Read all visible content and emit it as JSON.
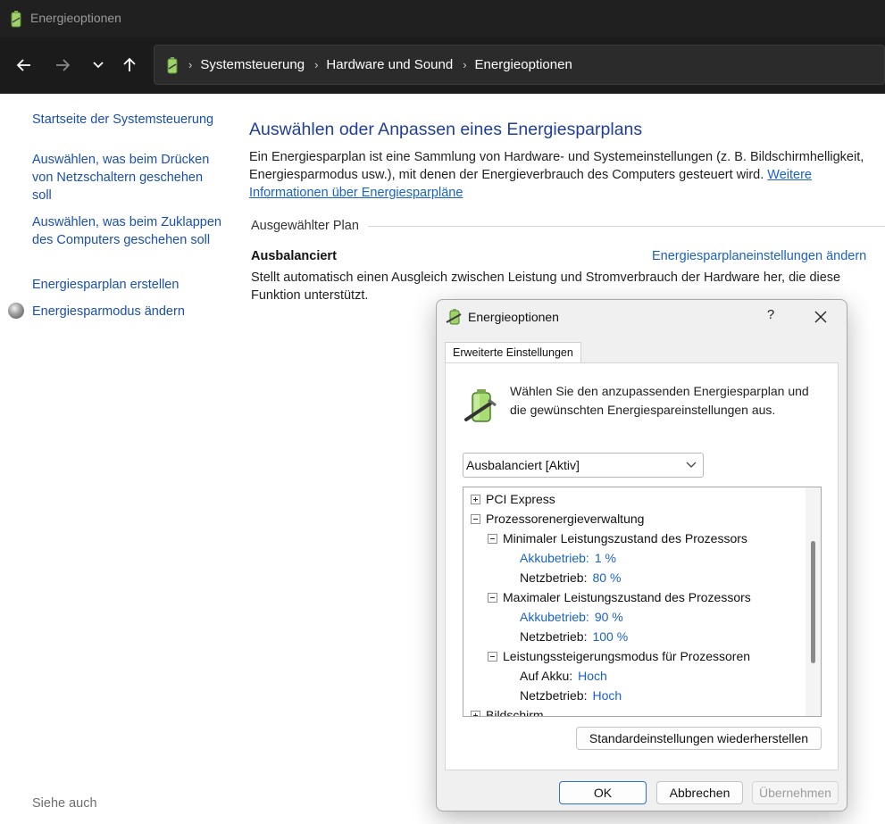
{
  "window": {
    "title": "Energieoptionen"
  },
  "breadcrumb": [
    "Systemsteuerung",
    "Hardware und Sound",
    "Energieoptionen"
  ],
  "left_pane": {
    "links": [
      "Startseite der Systemsteuerung",
      "Auswählen, was beim Drücken von Netzschaltern geschehen soll",
      "Auswählen, was beim Zuklappen des Computers geschehen soll",
      "Energiesparplan erstellen",
      "Energiesparmodus ändern"
    ],
    "see_also": "Siehe auch"
  },
  "main": {
    "title": "Auswählen oder Anpassen eines Energiesparplans",
    "intro_text": "Ein Energiesparplan ist eine Sammlung von Hardware- und Systemeinstellungen (z. B. Bildschirmhelligkeit, Energiesparmodus usw.), mit denen der Energieverbrauch des Computers gesteuert wird.",
    "intro_link": "Weitere Informationen über Energiesparpläne",
    "section_label": "Ausgewählter Plan",
    "plan_name": "Ausbalanciert",
    "plan_link": "Energiesparplaneinstellungen ändern",
    "plan_description": "Stellt automatisch einen Ausgleich zwischen Leistung und Stromverbrauch der Hardware her, die diese Funktion unterstützt."
  },
  "dialog": {
    "title": "Energieoptionen",
    "help": "?",
    "tab": "Erweiterte Einstellungen",
    "intro": "Wählen Sie den anzupassenden Energiesparplan und die gewünschten Energiespareinstellungen aus.",
    "plan_select": "Ausbalanciert [Aktiv]",
    "tree": {
      "pci_express": "PCI Express",
      "processor_mgmt": "Prozessorenergieverwaltung",
      "min_state": "Minimaler Leistungszustand des Prozessors",
      "min_battery_label": "Akkubetrieb:",
      "min_battery_value": "1 %",
      "min_ac_label": "Netzbetrieb:",
      "min_ac_value": "80 %",
      "max_state": "Maximaler Leistungszustand des Prozessors",
      "max_battery_label": "Akkubetrieb:",
      "max_battery_value": "90 %",
      "max_ac_label": "Netzbetrieb:",
      "max_ac_value": "100 %",
      "boost_mode": "Leistungssteigerungsmodus für Prozessoren",
      "boost_battery_label": "Auf Akku:",
      "boost_battery_value": "Hoch",
      "boost_ac_label": "Netzbetrieb:",
      "boost_ac_value": "Hoch",
      "display": "Bildschirm"
    },
    "restore_button": "Standardeinstellungen wiederherstellen",
    "ok_button": "OK",
    "cancel_button": "Abbrechen",
    "apply_button": "Übernehmen"
  }
}
